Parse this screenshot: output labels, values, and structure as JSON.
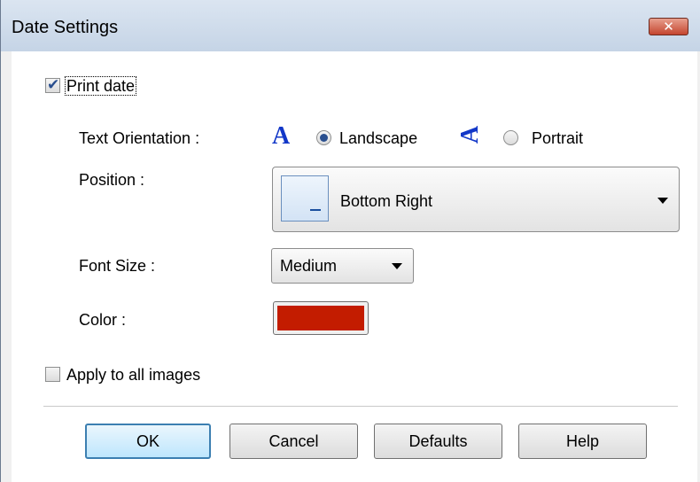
{
  "window": {
    "title": "Date Settings",
    "close_label": "✕"
  },
  "print_date": {
    "label": "Print date",
    "checked": true
  },
  "text_orientation": {
    "label": "Text Orientation :",
    "landscape_label": "Landscape",
    "portrait_label": "Portrait",
    "selected": "Landscape",
    "landscape_glyph": "A",
    "portrait_glyph": "A"
  },
  "position": {
    "label": "Position :",
    "value": "Bottom Right"
  },
  "font_size": {
    "label": "Font Size :",
    "value": "Medium"
  },
  "color": {
    "label": "Color :",
    "value": "#c31c00"
  },
  "apply_all": {
    "label": "Apply to all images",
    "checked": false
  },
  "buttons": {
    "ok": "OK",
    "cancel": "Cancel",
    "defaults": "Defaults",
    "help": "Help"
  },
  "icons": {
    "landscape": "text-landscape-icon",
    "portrait": "text-portrait-icon",
    "position_preview": "position-bottom-right-icon",
    "dropdown": "chevron-down-icon",
    "check": "checkmark-icon"
  }
}
